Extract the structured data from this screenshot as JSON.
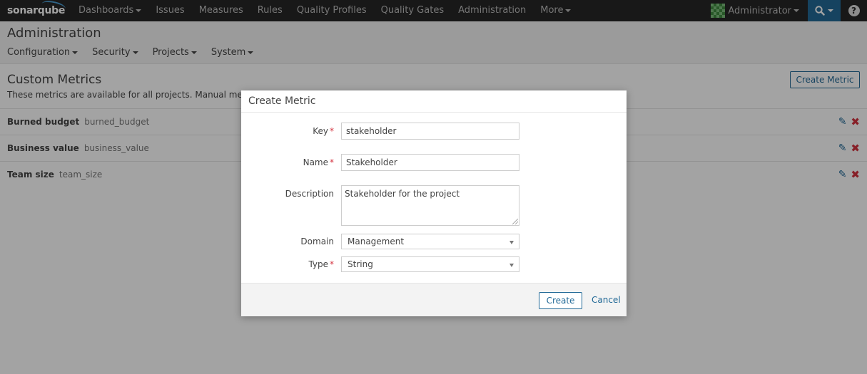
{
  "nav": {
    "logo": "sonarqube",
    "items": [
      {
        "label": "Dashboards",
        "dropdown": true
      },
      {
        "label": "Issues",
        "dropdown": false
      },
      {
        "label": "Measures",
        "dropdown": false
      },
      {
        "label": "Rules",
        "dropdown": false
      },
      {
        "label": "Quality Profiles",
        "dropdown": false
      },
      {
        "label": "Quality Gates",
        "dropdown": false
      },
      {
        "label": "Administration",
        "dropdown": false
      },
      {
        "label": "More",
        "dropdown": true
      }
    ],
    "user": "Administrator",
    "help": "?"
  },
  "admin": {
    "title": "Administration",
    "menu": [
      "Configuration",
      "Security",
      "Projects",
      "System"
    ]
  },
  "page": {
    "title": "Custom Metrics",
    "description": "These metrics are available for all projects. Manual measures",
    "create_button": "Create Metric",
    "metrics": [
      {
        "name": "Burned budget",
        "key": "burned_budget"
      },
      {
        "name": "Business value",
        "key": "business_value"
      },
      {
        "name": "Team size",
        "key": "team_size"
      }
    ]
  },
  "modal": {
    "title": "Create Metric",
    "key_label": "Key",
    "key_value": "stakeholder",
    "name_label": "Name",
    "name_value": "Stakeholder",
    "description_label": "Description",
    "description_value": "Stakeholder for the project",
    "domain_label": "Domain",
    "domain_value": "Management",
    "type_label": "Type",
    "type_value": "String",
    "required_marker": "*",
    "create_button": "Create",
    "cancel_link": "Cancel"
  },
  "colors": {
    "nav_bg": "#262626",
    "accent": "#236a97",
    "danger": "#d4333f"
  }
}
